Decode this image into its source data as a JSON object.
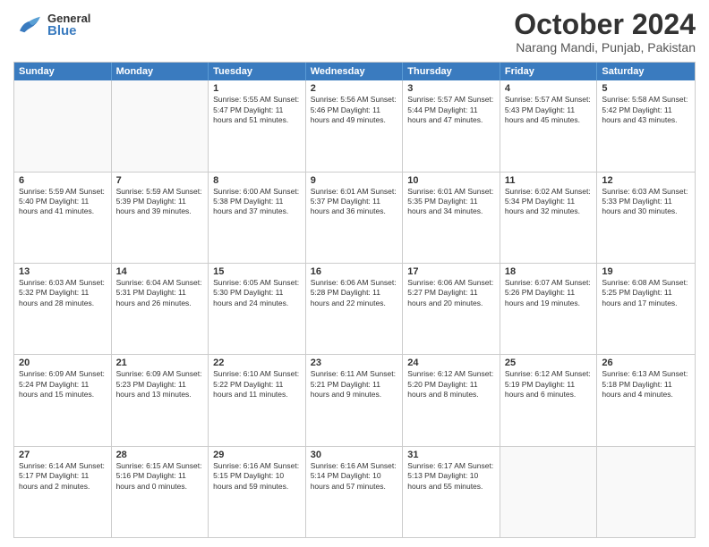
{
  "header": {
    "logo": {
      "general": "General",
      "blue": "Blue"
    },
    "title": "October 2024",
    "subtitle": "Narang Mandi, Punjab, Pakistan"
  },
  "calendar": {
    "days": [
      "Sunday",
      "Monday",
      "Tuesday",
      "Wednesday",
      "Thursday",
      "Friday",
      "Saturday"
    ],
    "rows": [
      [
        {
          "day": "",
          "info": ""
        },
        {
          "day": "",
          "info": ""
        },
        {
          "day": "1",
          "info": "Sunrise: 5:55 AM\nSunset: 5:47 PM\nDaylight: 11 hours and 51 minutes."
        },
        {
          "day": "2",
          "info": "Sunrise: 5:56 AM\nSunset: 5:46 PM\nDaylight: 11 hours and 49 minutes."
        },
        {
          "day": "3",
          "info": "Sunrise: 5:57 AM\nSunset: 5:44 PM\nDaylight: 11 hours and 47 minutes."
        },
        {
          "day": "4",
          "info": "Sunrise: 5:57 AM\nSunset: 5:43 PM\nDaylight: 11 hours and 45 minutes."
        },
        {
          "day": "5",
          "info": "Sunrise: 5:58 AM\nSunset: 5:42 PM\nDaylight: 11 hours and 43 minutes."
        }
      ],
      [
        {
          "day": "6",
          "info": "Sunrise: 5:59 AM\nSunset: 5:40 PM\nDaylight: 11 hours and 41 minutes."
        },
        {
          "day": "7",
          "info": "Sunrise: 5:59 AM\nSunset: 5:39 PM\nDaylight: 11 hours and 39 minutes."
        },
        {
          "day": "8",
          "info": "Sunrise: 6:00 AM\nSunset: 5:38 PM\nDaylight: 11 hours and 37 minutes."
        },
        {
          "day": "9",
          "info": "Sunrise: 6:01 AM\nSunset: 5:37 PM\nDaylight: 11 hours and 36 minutes."
        },
        {
          "day": "10",
          "info": "Sunrise: 6:01 AM\nSunset: 5:35 PM\nDaylight: 11 hours and 34 minutes."
        },
        {
          "day": "11",
          "info": "Sunrise: 6:02 AM\nSunset: 5:34 PM\nDaylight: 11 hours and 32 minutes."
        },
        {
          "day": "12",
          "info": "Sunrise: 6:03 AM\nSunset: 5:33 PM\nDaylight: 11 hours and 30 minutes."
        }
      ],
      [
        {
          "day": "13",
          "info": "Sunrise: 6:03 AM\nSunset: 5:32 PM\nDaylight: 11 hours and 28 minutes."
        },
        {
          "day": "14",
          "info": "Sunrise: 6:04 AM\nSunset: 5:31 PM\nDaylight: 11 hours and 26 minutes."
        },
        {
          "day": "15",
          "info": "Sunrise: 6:05 AM\nSunset: 5:30 PM\nDaylight: 11 hours and 24 minutes."
        },
        {
          "day": "16",
          "info": "Sunrise: 6:06 AM\nSunset: 5:28 PM\nDaylight: 11 hours and 22 minutes."
        },
        {
          "day": "17",
          "info": "Sunrise: 6:06 AM\nSunset: 5:27 PM\nDaylight: 11 hours and 20 minutes."
        },
        {
          "day": "18",
          "info": "Sunrise: 6:07 AM\nSunset: 5:26 PM\nDaylight: 11 hours and 19 minutes."
        },
        {
          "day": "19",
          "info": "Sunrise: 6:08 AM\nSunset: 5:25 PM\nDaylight: 11 hours and 17 minutes."
        }
      ],
      [
        {
          "day": "20",
          "info": "Sunrise: 6:09 AM\nSunset: 5:24 PM\nDaylight: 11 hours and 15 minutes."
        },
        {
          "day": "21",
          "info": "Sunrise: 6:09 AM\nSunset: 5:23 PM\nDaylight: 11 hours and 13 minutes."
        },
        {
          "day": "22",
          "info": "Sunrise: 6:10 AM\nSunset: 5:22 PM\nDaylight: 11 hours and 11 minutes."
        },
        {
          "day": "23",
          "info": "Sunrise: 6:11 AM\nSunset: 5:21 PM\nDaylight: 11 hours and 9 minutes."
        },
        {
          "day": "24",
          "info": "Sunrise: 6:12 AM\nSunset: 5:20 PM\nDaylight: 11 hours and 8 minutes."
        },
        {
          "day": "25",
          "info": "Sunrise: 6:12 AM\nSunset: 5:19 PM\nDaylight: 11 hours and 6 minutes."
        },
        {
          "day": "26",
          "info": "Sunrise: 6:13 AM\nSunset: 5:18 PM\nDaylight: 11 hours and 4 minutes."
        }
      ],
      [
        {
          "day": "27",
          "info": "Sunrise: 6:14 AM\nSunset: 5:17 PM\nDaylight: 11 hours and 2 minutes."
        },
        {
          "day": "28",
          "info": "Sunrise: 6:15 AM\nSunset: 5:16 PM\nDaylight: 11 hours and 0 minutes."
        },
        {
          "day": "29",
          "info": "Sunrise: 6:16 AM\nSunset: 5:15 PM\nDaylight: 10 hours and 59 minutes."
        },
        {
          "day": "30",
          "info": "Sunrise: 6:16 AM\nSunset: 5:14 PM\nDaylight: 10 hours and 57 minutes."
        },
        {
          "day": "31",
          "info": "Sunrise: 6:17 AM\nSunset: 5:13 PM\nDaylight: 10 hours and 55 minutes."
        },
        {
          "day": "",
          "info": ""
        },
        {
          "day": "",
          "info": ""
        }
      ]
    ]
  }
}
